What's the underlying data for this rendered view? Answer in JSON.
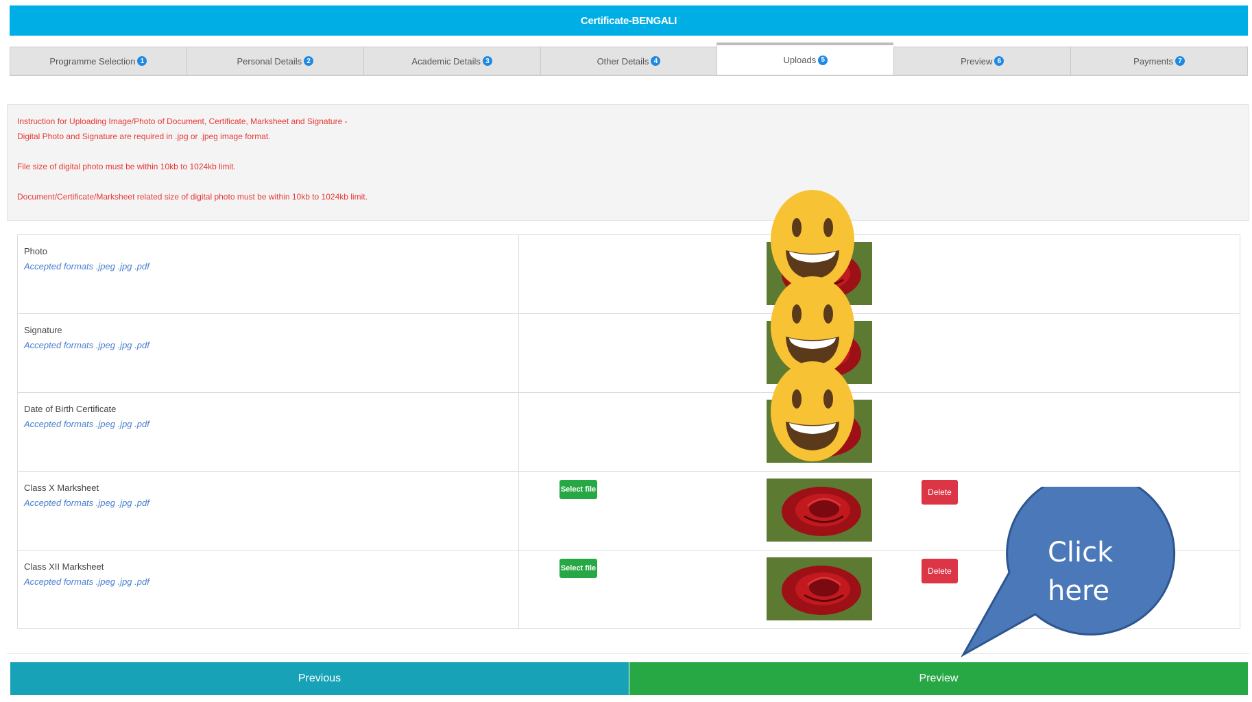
{
  "header": {
    "title": "Certificate-BENGALI"
  },
  "tabs": [
    {
      "label": "Programme Selection",
      "num": "1"
    },
    {
      "label": "Personal Details",
      "num": "2"
    },
    {
      "label": "Academic Details",
      "num": "3"
    },
    {
      "label": "Other Details",
      "num": "4"
    },
    {
      "label": "Uploads",
      "num": "5"
    },
    {
      "label": "Preview",
      "num": "6"
    },
    {
      "label": "Payments",
      "num": "7"
    }
  ],
  "active_tab": "Uploads",
  "instructions": {
    "line1": "Instruction for Uploading Image/Photo of Document, Certificate, Marksheet and Signature -",
    "line2": "Digital Photo and Signature are required in .jpg or .jpeg image format.",
    "line3": "File size of digital photo must be within 10kb to 1024kb limit.",
    "line4": "Document/Certificate/Marksheet related size of digital photo must be within 10kb to 1024kb limit."
  },
  "uploads": {
    "rows": [
      {
        "label": "Photo",
        "hint": "Accepted formats .jpeg .jpg .pdf"
      },
      {
        "label": "Signature",
        "hint": "Accepted formats .jpeg .jpg .pdf"
      },
      {
        "label": "Date of Birth Certificate",
        "hint": "Accepted formats .jpeg .jpg .pdf"
      },
      {
        "label": "Class X Marksheet",
        "hint": "Accepted formats .jpeg .jpg .pdf",
        "select_label": "Select file",
        "delete_label": "Delete"
      },
      {
        "label": "Class XII Marksheet",
        "hint": "Accepted formats .jpeg .jpg .pdf",
        "select_label": "Select file",
        "delete_label": "Delete"
      }
    ]
  },
  "footer": {
    "previous_label": "Previous",
    "preview_label": "Preview"
  },
  "callout": {
    "line1": "Click",
    "line2": "here"
  },
  "colors": {
    "header": "#00aee6",
    "tab_badge": "#1e88e5",
    "instruction_text": "#e53935",
    "hint_text": "#4a7fd1",
    "select_button": "#28a745",
    "delete_button": "#dc3545",
    "previous_button": "#17a2b8",
    "preview_button": "#28a745",
    "callout": "#4a78b8"
  }
}
